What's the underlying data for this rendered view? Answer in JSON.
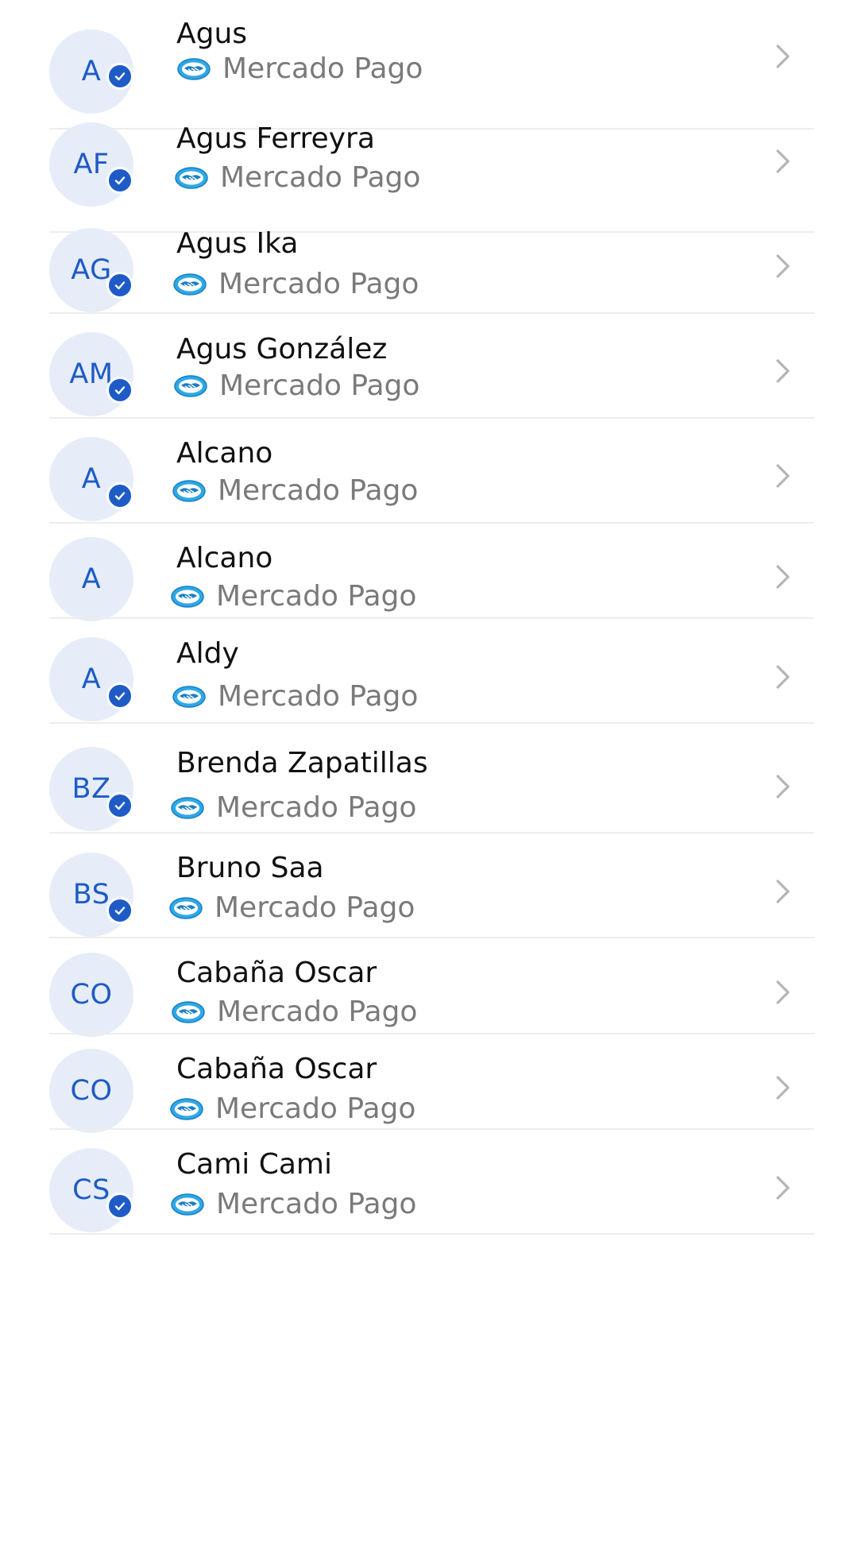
{
  "colors": {
    "accent": "#1e5bc6",
    "avatar_bg": "#e6edf8",
    "name_text": "#111111",
    "provider_text": "#7a7a7a",
    "chevron": "#b5b5b5",
    "divider": "#ededed"
  },
  "icons": {
    "verified": "check-circle-icon",
    "provider": "mercado-pago-handshake-icon",
    "row_action": "chevron-right-icon"
  },
  "contacts": [
    {
      "initials": "A",
      "name": "Agus",
      "provider": "Mercado Pago",
      "verified": true
    },
    {
      "initials": "AF",
      "name": "Agus Ferreyra",
      "provider": "Mercado Pago",
      "verified": true
    },
    {
      "initials": "AG",
      "name": "Agus Ika",
      "provider": "Mercado Pago",
      "verified": true
    },
    {
      "initials": "AM",
      "name": "Agus González",
      "provider": "Mercado Pago",
      "verified": true
    },
    {
      "initials": "A",
      "name": "Alcano",
      "provider": "Mercado Pago",
      "verified": true
    },
    {
      "initials": "A",
      "name": "Alcano",
      "provider": "Mercado Pago",
      "verified": false
    },
    {
      "initials": "A",
      "name": "Aldy",
      "provider": "Mercado Pago",
      "verified": true
    },
    {
      "initials": "BZ",
      "name": "Brenda Zapatillas",
      "provider": "Mercado Pago",
      "verified": true
    },
    {
      "initials": "BS",
      "name": "Bruno Saa",
      "provider": "Mercado Pago",
      "verified": true
    },
    {
      "initials": "CO",
      "name": "Cabaña Oscar",
      "provider": "Mercado Pago",
      "verified": false
    },
    {
      "initials": "CO",
      "name": "Cabaña Oscar",
      "provider": "Mercado Pago",
      "verified": false
    },
    {
      "initials": "CS",
      "name": "Cami  Cami",
      "provider": "Mercado Pago",
      "verified": true
    }
  ]
}
